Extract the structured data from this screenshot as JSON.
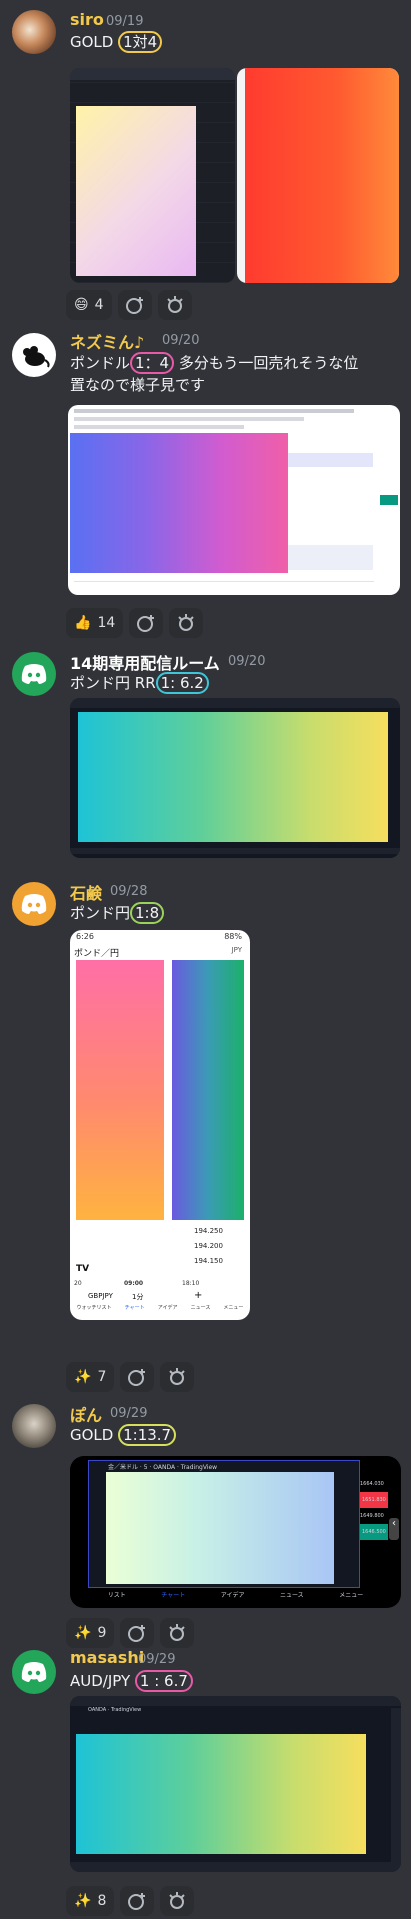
{
  "messages": [
    {
      "username": "siro",
      "username_color": "#f2c94c",
      "timestamp": "09/19",
      "text_prefix": "GOLD ",
      "text_ratio": "1対4",
      "ratio_circle_color": "#f2c94c",
      "reactions": [
        {
          "emoji": "😄",
          "count": "4"
        }
      ]
    },
    {
      "username": "ネズミん♪",
      "username_color": "#f2c94c",
      "timestamp": "09/20",
      "text_prefix": "ポンドル",
      "text_ratio": "1：4",
      "ratio_circle_color": "#e859a8",
      "text_suffix": "  多分もう一回売れそうな位",
      "text_line2": "置なので様子見です",
      "reactions": [
        {
          "emoji": "👍",
          "count": "14"
        }
      ]
    },
    {
      "username": "14期専用配信ルーム",
      "username_color": "#ffffff",
      "timestamp": "09/20",
      "text_prefix": "ポンド円 RR",
      "text_ratio": "1: 6.2",
      "ratio_circle_color": "#3ec7d8",
      "reactions": []
    },
    {
      "username": "石鹸",
      "username_color": "#f2c94c",
      "timestamp": "09/28",
      "text_prefix": "ポンド円",
      "text_ratio": "1:8",
      "ratio_circle_color": "#9bd35a",
      "reactions": [
        {
          "emoji": "✨",
          "count": "7"
        }
      ],
      "phone": {
        "time": "6:26",
        "battery": "88%",
        "pair_title": "ポンド／円",
        "currency_label": "JPY",
        "price_ticks": [
          "194.250",
          "194.200",
          "194.150"
        ],
        "time_axis": [
          "20",
          "09:00",
          "18:10"
        ],
        "symbol": "GBPJPY",
        "interval": "1分",
        "nav": [
          "ウォッチリスト",
          "チャート",
          "アイデア",
          "ニュース",
          "メニュー"
        ]
      }
    },
    {
      "username": "ぽん",
      "username_color": "#f2c94c",
      "timestamp": "09/29",
      "text_prefix": "GOLD ",
      "text_ratio": "1:13.7",
      "ratio_circle_color": "#d6e05a",
      "reactions": [
        {
          "emoji": "✨",
          "count": "9"
        }
      ],
      "tablet": {
        "title": "金／米ドル · 5 · OANDA · TradingView",
        "prices": [
          "1664.030",
          "1651.830",
          "1649.800",
          "1646.500"
        ],
        "nav": [
          "リスト",
          "チャート",
          "アイデア",
          "ニュース",
          "メニュー"
        ]
      }
    },
    {
      "username": "masashi",
      "username_color": "#f2c94c",
      "timestamp": "09/29",
      "text_prefix": "AUD/JPY  ",
      "text_ratio": "1 : 6.7",
      "ratio_circle_color": "#e859a8",
      "reactions": [
        {
          "emoji": "✨",
          "count": "8"
        }
      ],
      "chart_title": "OANDA · TradingView"
    }
  ],
  "icons": {
    "add_reaction": "add-reaction-icon",
    "super_reaction": "super-reaction-icon",
    "discord_logo": "discord-logo-icon",
    "mouse_avatar": "mouse-icon"
  },
  "colors": {
    "background": "#313338",
    "reaction_bg": "#2b2d31",
    "timestamp": "#949ba4"
  }
}
